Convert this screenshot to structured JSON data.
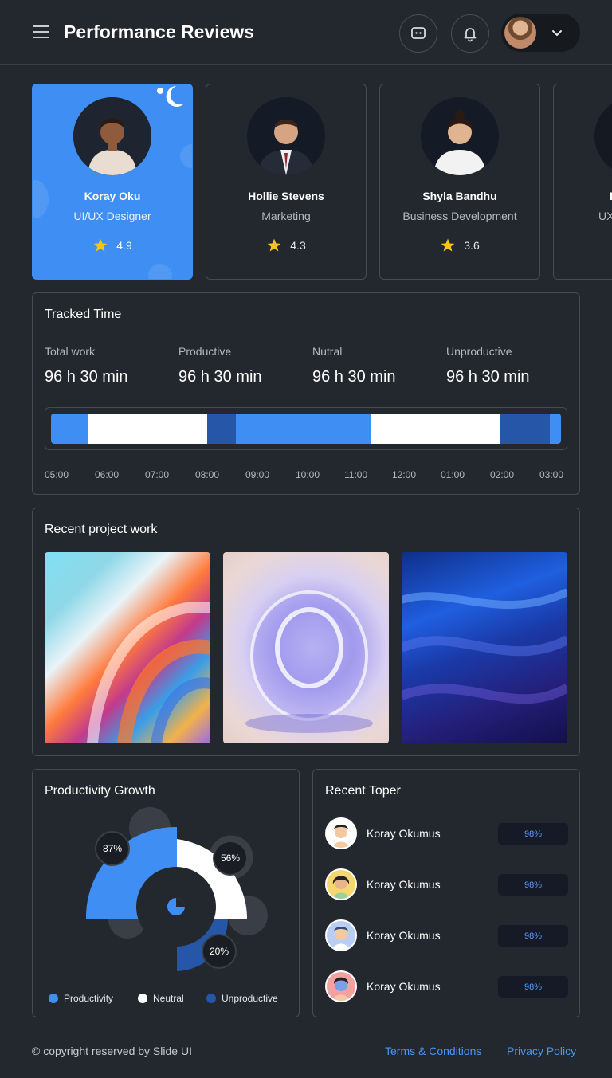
{
  "header": {
    "title": "Performance Reviews",
    "icons": [
      "menu-icon",
      "chat-icon",
      "bell-icon",
      "chevron-down-icon"
    ]
  },
  "employees": [
    {
      "name": "Koray Oku",
      "role": "UI/UX Designer",
      "rating": "4.9"
    },
    {
      "name": "Hollie Stevens",
      "role": "Marketing",
      "rating": "4.3"
    },
    {
      "name": "Shyla Bandhu",
      "role": "Business Development",
      "rating": "3.6"
    },
    {
      "name": "F",
      "role": "UX"
    }
  ],
  "tracked_time": {
    "title": "Tracked Time",
    "stats": [
      {
        "label": "Total work",
        "value": "96 h 30 min"
      },
      {
        "label": "Productive",
        "value": "96 h 30 min"
      },
      {
        "label": "Nutral",
        "value": "96 h 30 min"
      },
      {
        "label": "Unproductive",
        "value": "96 h 30 min"
      }
    ],
    "ticks": [
      "05:00",
      "06:00",
      "07:00",
      "08:00",
      "09:00",
      "10:00",
      "11:00",
      "12:00",
      "01:00",
      "02:00",
      "03:00"
    ]
  },
  "recent_projects": {
    "title": "Recent project work"
  },
  "productivity": {
    "title": "Productivity Growth",
    "labels": {
      "productive": "87%",
      "neutral": "56%",
      "unproductive": "20%"
    },
    "legend": [
      "Productivity",
      "Neutral",
      "Unproductive"
    ],
    "colors": {
      "productive": "#3f8ef3",
      "neutral": "#ffffff",
      "unproductive": "#2556a8"
    }
  },
  "recent_toper": {
    "title": "Recent Toper",
    "rows": [
      {
        "name": "Koray Okumus",
        "score": "98%"
      },
      {
        "name": "Koray Okumus",
        "score": "98%"
      },
      {
        "name": "Koray Okumus",
        "score": "98%"
      },
      {
        "name": "Koray Okumus",
        "score": "98%"
      }
    ]
  },
  "footer": {
    "copyright": "© copyright reserved by Slide UI",
    "terms": "Terms & Conditions",
    "privacy": "Privacy Policy"
  },
  "colors": {
    "background": "#23272e",
    "accent": "#3f8ef3",
    "dark_blue": "#2556a8",
    "star": "#f5c518"
  }
}
